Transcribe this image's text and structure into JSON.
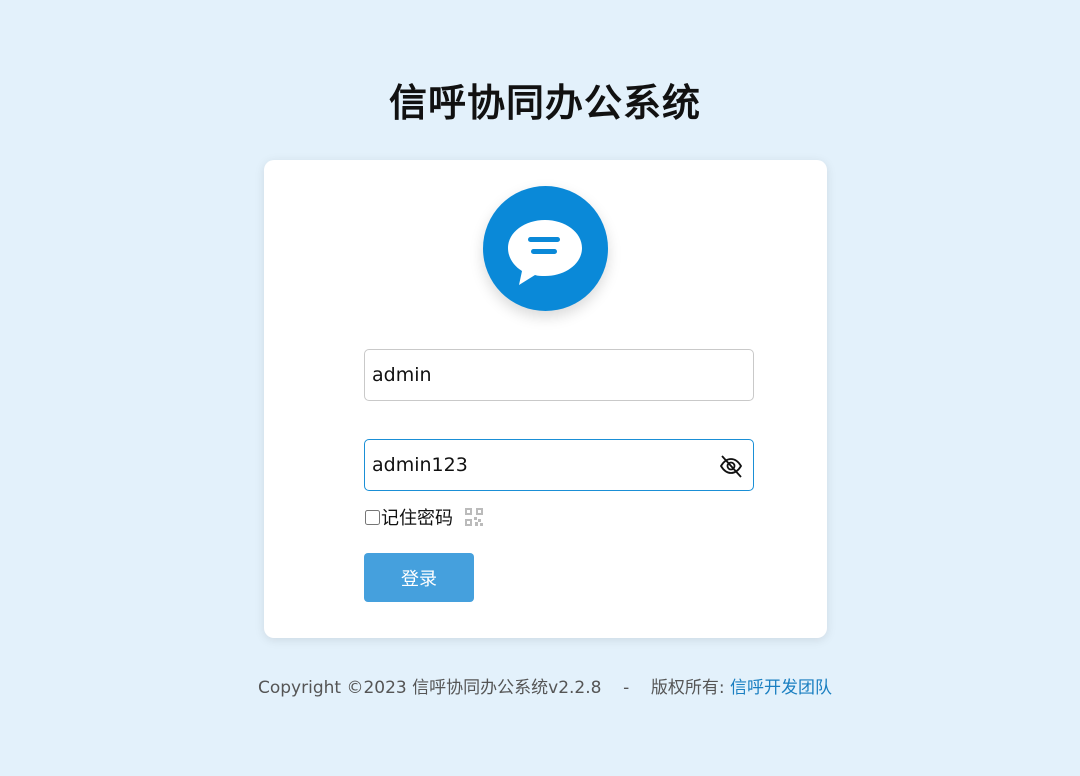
{
  "header": {
    "title": "信呼协同办公系统"
  },
  "login": {
    "username_value": "admin",
    "password_value": "admin123",
    "remember_label": "记住密码",
    "login_button": "登录"
  },
  "footer": {
    "copyright": "Copyright ©2023 信呼协同办公系统v2.2.8",
    "separator": "-",
    "rights_label": "版权所有:",
    "team_link": "信呼开发团队"
  },
  "colors": {
    "background": "#e3f1fb",
    "accent": "#0a89d8",
    "button": "#45a0dd",
    "link": "#1a7fc1"
  },
  "icons": {
    "logo": "chat-bubble-icon",
    "password_toggle": "eye-off-icon",
    "qr": "qr-code-icon"
  }
}
